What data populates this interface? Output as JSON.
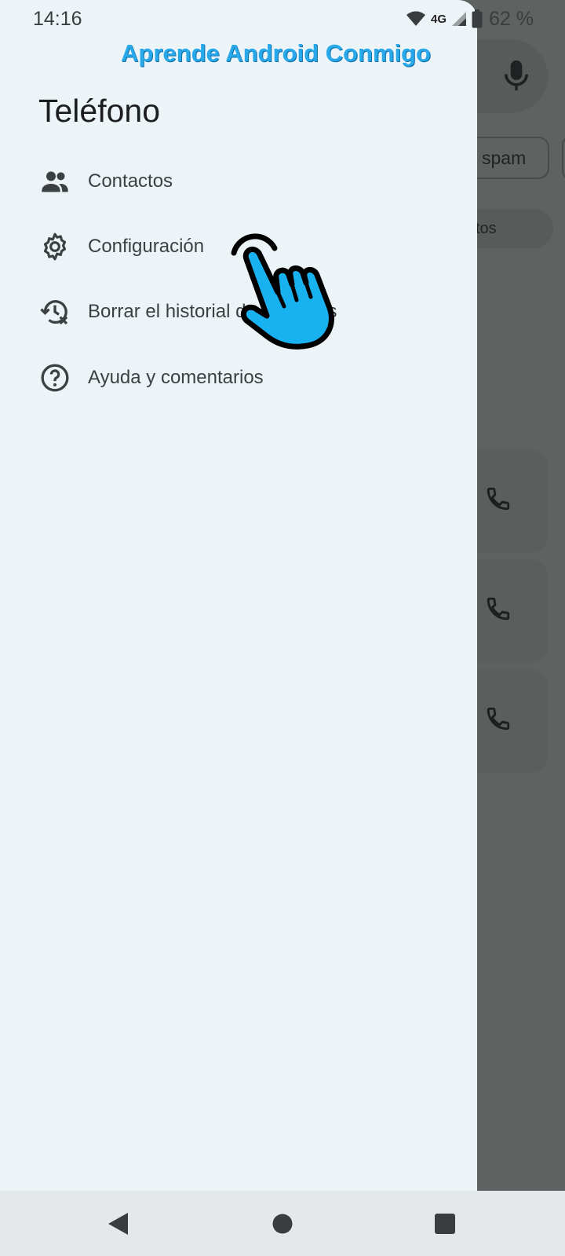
{
  "status_bar": {
    "time": "14:16",
    "network": "4G",
    "battery": "62 %"
  },
  "watermark": "Aprende Android Conmigo",
  "drawer": {
    "title": "Teléfono",
    "items": [
      {
        "label": "Contactos",
        "icon": "contacts-icon"
      },
      {
        "label": "Configuración",
        "icon": "gear-icon"
      },
      {
        "label": "Borrar el historial de llamadas",
        "icon": "clear-history-icon"
      },
      {
        "label": "Ayuda y comentarios",
        "icon": "help-icon"
      }
    ]
  },
  "background_app": {
    "chip_label": "spam",
    "pill_label": "ctos"
  },
  "colors": {
    "drawer_bg": "#edf4f8",
    "scrim": "#5e6362",
    "watermark": "#29a9ea",
    "hand": "#19b2f0"
  }
}
